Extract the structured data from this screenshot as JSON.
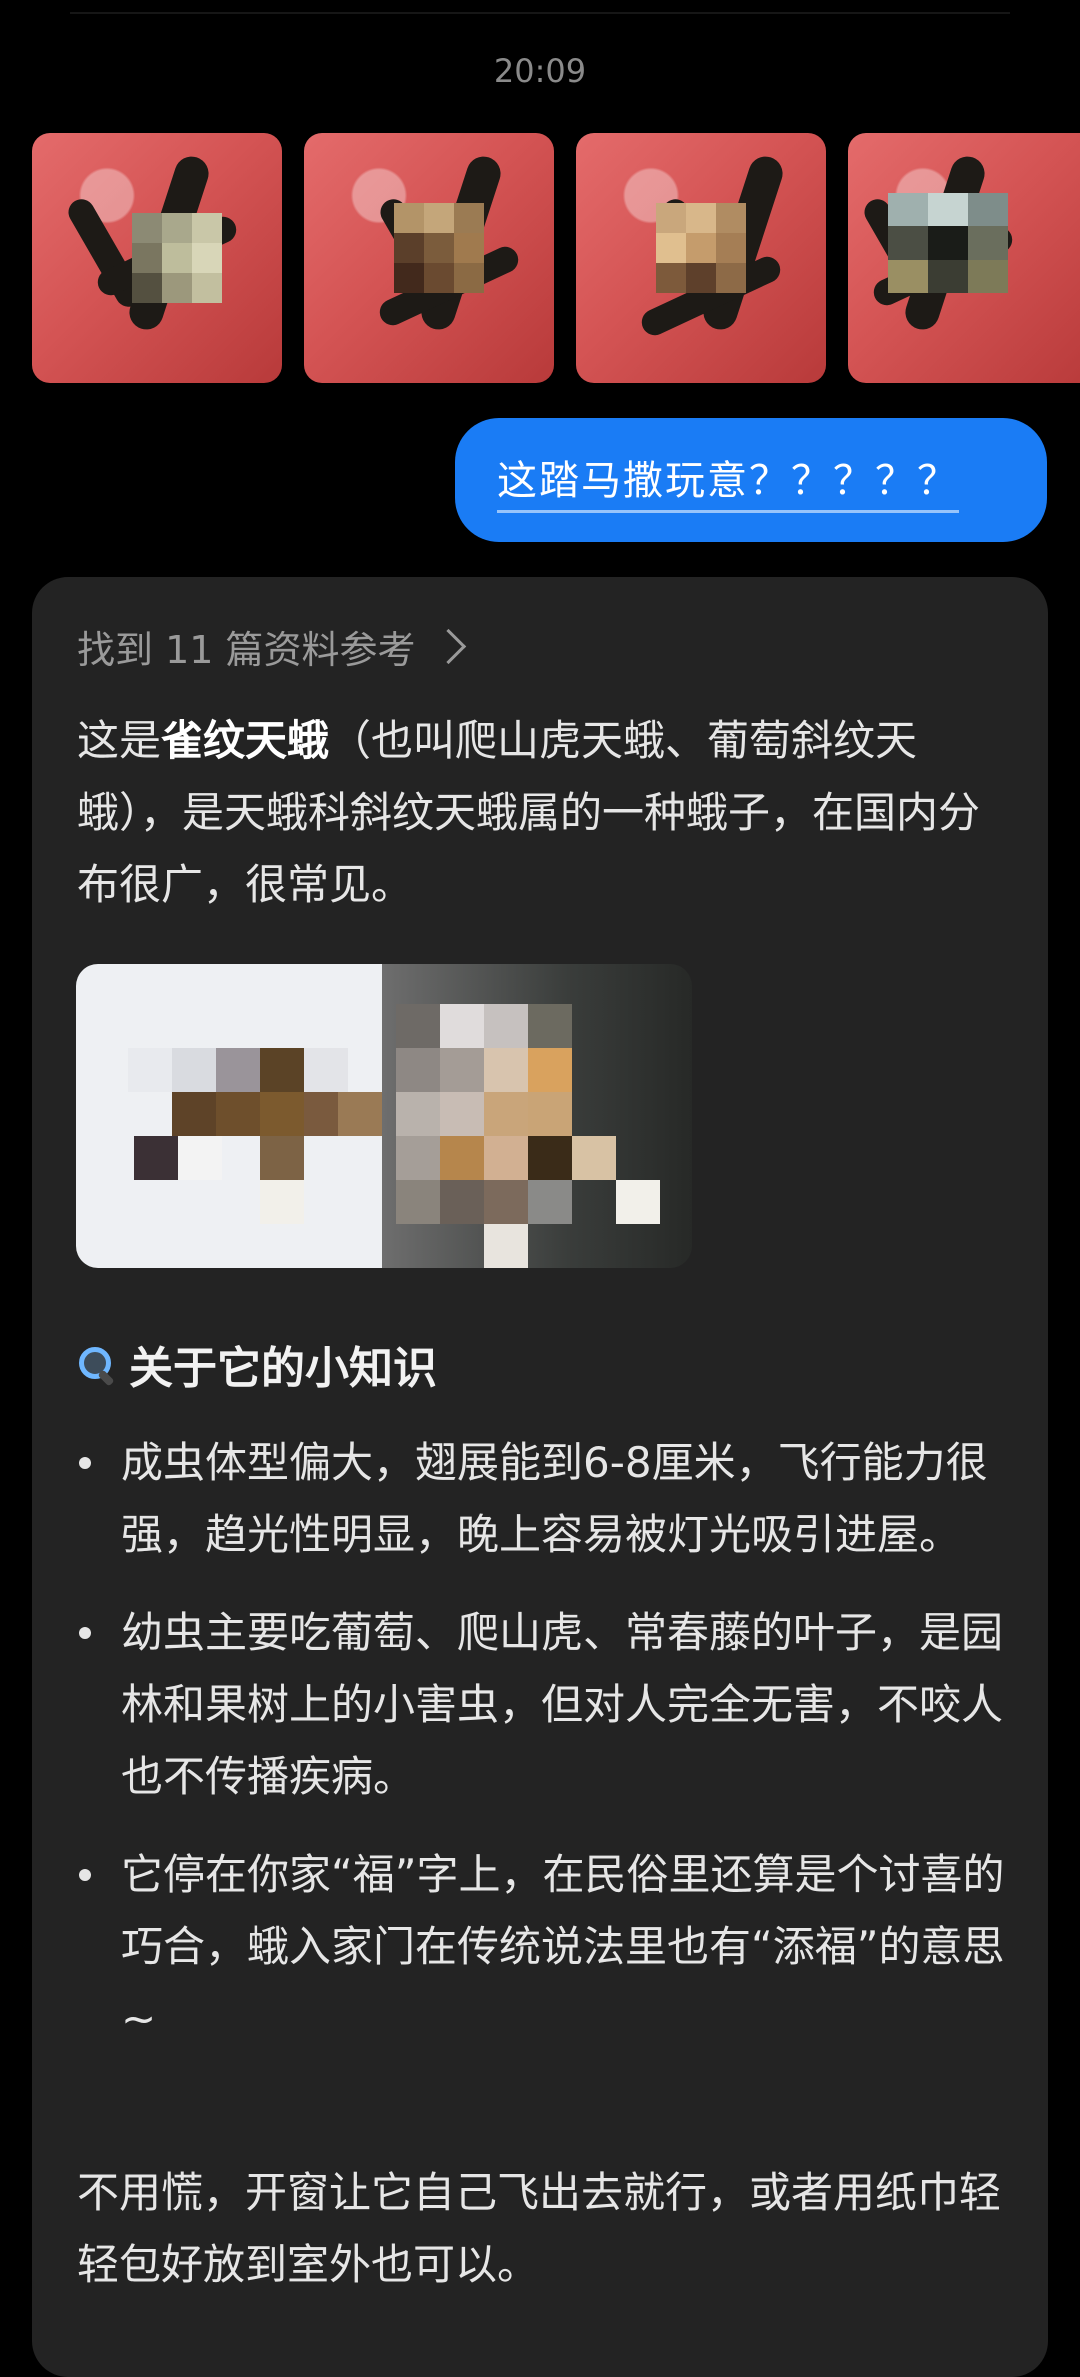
{
  "conversation": {
    "timestamp": "20:09",
    "user_message": "这踏马撒玩意？？？？？",
    "assistant": {
      "sources_label": "找到 11 篇资料参考",
      "intro": {
        "prefix": "这是",
        "species": "雀纹天蛾",
        "suffix": "（也叫爬山虎天蛾、葡萄斜纹天蛾），是天蛾科斜纹天蛾属的一种蛾子，在国内分布很广，很常见。"
      },
      "section_title": "关于它的小知识",
      "bullets": [
        "成虫体型偏大，翅展能到6-8厘米，飞行能力很强，趋光性明显，晚上容易被灯光吸引进屋。",
        "幼虫主要吃葡萄、爬山虎、常春藤的叶子，是园林和果树上的小害虫，但对人完全无害，不咬人也不传播疾病。",
        "它停在你家“福”字上，在民俗里还算是个讨喜的巧合，蛾入家门在传统说法里也有“添福”的意思~"
      ],
      "closing": "不用慌，开窗让它自己飞出去就行，或者用纸巾轻轻包好放到室外也可以。"
    }
  },
  "colors": {
    "background": "#000000",
    "user_bubble": "#1a7cf5",
    "card": "#232323",
    "muted_text": "#9a9a9a"
  }
}
